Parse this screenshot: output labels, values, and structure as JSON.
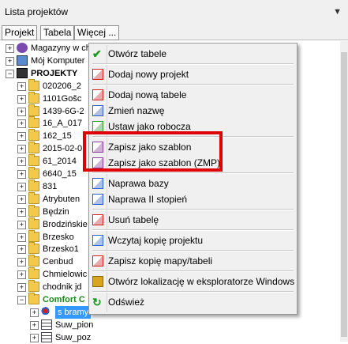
{
  "panel": {
    "title": "Lista projektów",
    "menu_glyph": "▼"
  },
  "tabs": [
    "Projekt",
    "Tabela",
    "Więcej ..."
  ],
  "tree": [
    {
      "label": "Magazyny w ch",
      "level": 0,
      "icon": "user-db-icon",
      "expander": "+"
    },
    {
      "label": "Mój Komputer",
      "level": 0,
      "icon": "computer-icon",
      "expander": "+"
    },
    {
      "label": "PROJEKTY",
      "level": 0,
      "icon": "book-icon",
      "expander": "−",
      "bold": true
    },
    {
      "label": "020206_2",
      "level": 1,
      "icon": "folder-icon",
      "expander": "+"
    },
    {
      "label": "1101Gošc",
      "level": 1,
      "icon": "folder-icon",
      "expander": "+"
    },
    {
      "label": "1439-6G-2",
      "level": 1,
      "icon": "folder-icon",
      "expander": "+"
    },
    {
      "label": "16_A_017",
      "level": 1,
      "icon": "folder-icon",
      "expander": "+"
    },
    {
      "label": "162_15",
      "level": 1,
      "icon": "folder-icon",
      "expander": "+"
    },
    {
      "label": "2015-02-0",
      "level": 1,
      "icon": "folder-icon",
      "expander": "+"
    },
    {
      "label": "61_2014",
      "level": 1,
      "icon": "folder-icon",
      "expander": "+"
    },
    {
      "label": "6640_15",
      "level": 1,
      "icon": "folder-icon",
      "expander": "+"
    },
    {
      "label": "831",
      "level": 1,
      "icon": "folder-icon",
      "expander": "+"
    },
    {
      "label": "Atrybuten",
      "level": 1,
      "icon": "folder-icon",
      "expander": "+"
    },
    {
      "label": "Będzin",
      "level": 1,
      "icon": "folder-icon",
      "expander": "+"
    },
    {
      "label": "Brodzińskie",
      "level": 1,
      "icon": "folder-icon",
      "expander": "+"
    },
    {
      "label": "Brzesko",
      "level": 1,
      "icon": "folder-icon",
      "expander": "+"
    },
    {
      "label": "Brzesko1",
      "level": 1,
      "icon": "folder-icon",
      "expander": "+"
    },
    {
      "label": "Cenbud",
      "level": 1,
      "icon": "folder-icon",
      "expander": "+"
    },
    {
      "label": "Chmielowic",
      "level": 1,
      "icon": "folder-icon",
      "expander": "+"
    },
    {
      "label": "chodnik jd",
      "level": 1,
      "icon": "folder-icon",
      "expander": "+"
    },
    {
      "label": "Comfort C",
      "level": 1,
      "icon": "folder-icon",
      "expander": "−",
      "green": true
    },
    {
      "label": "s bramy",
      "level": 2,
      "icon": "map-icon",
      "expander": "+",
      "selected": true
    },
    {
      "label": "Suw_pion",
      "level": 2,
      "icon": "table-icon",
      "expander": "+"
    },
    {
      "label": "Suw_poz",
      "level": 2,
      "icon": "table-icon",
      "expander": "+"
    }
  ],
  "context_menu": [
    {
      "label": "Otwórz tabele",
      "icon": "checkmark-icon",
      "color": "#1a9a1a"
    },
    {
      "sep": true
    },
    {
      "label": "Dodaj nowy projekt",
      "icon": "new-project-icon",
      "color": "#d42020"
    },
    {
      "sep": true
    },
    {
      "label": "Dodaj nową tabele",
      "icon": "new-table-icon",
      "color": "#d42020"
    },
    {
      "label": "Zmień nazwę",
      "icon": "rename-icon",
      "color": "#3060c0"
    },
    {
      "label": "Ustaw jako robocza",
      "icon": "set-working-icon",
      "color": "#2a9a2a"
    },
    {
      "sep": true
    },
    {
      "label": "Zapisz jako szablon",
      "icon": "template-icon",
      "color": "#8a3aa0"
    },
    {
      "label": "Zapisz jako szablon (ZMP)",
      "icon": "template-zmp-icon",
      "color": "#8a3aa0"
    },
    {
      "sep": true
    },
    {
      "label": "Naprawa bazy",
      "icon": "repair-icon",
      "color": "#2b5fd0"
    },
    {
      "label": "Naprawa II stopień",
      "icon": "repair-2-icon",
      "color": "#2b5fd0"
    },
    {
      "sep": true
    },
    {
      "label": "Usuń tabelę",
      "icon": "delete-table-icon",
      "color": "#d42020"
    },
    {
      "sep": true
    },
    {
      "label": "Wczytaj kopię projektu",
      "icon": "load-copy-icon",
      "color": "#2a6ad0"
    },
    {
      "sep": true
    },
    {
      "label": "Zapisz kopię mapy/tabeli",
      "icon": "save-copy-icon",
      "color": "#d42020"
    },
    {
      "sep": true
    },
    {
      "label": "Otwórz lokalizację w eksploratorze Windows",
      "icon": "open-folder-icon",
      "color": "#d9a520"
    },
    {
      "sep": true
    },
    {
      "label": "Odśwież",
      "icon": "refresh-icon",
      "color": "#1a9a1a"
    }
  ],
  "highlight_color": "#e00000"
}
